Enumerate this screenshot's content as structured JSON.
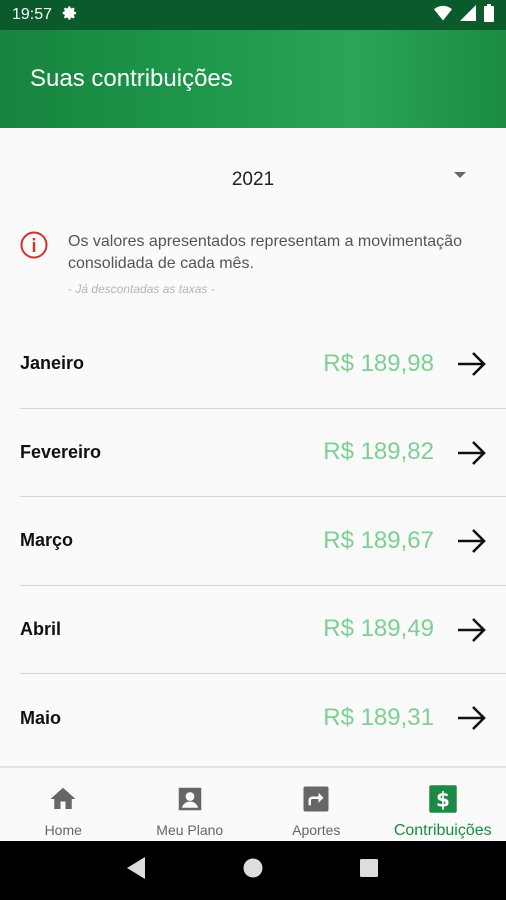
{
  "status_bar": {
    "time": "19:57"
  },
  "app_bar": {
    "title": "Suas contribuições"
  },
  "filter": {
    "year": "2021"
  },
  "notice": {
    "message": "Os valores apresentados representam a movimentação consolidada de cada mês.",
    "note": "- Já descontadas as taxas -"
  },
  "months": [
    {
      "name": "Janeiro",
      "amount": "R$ 189,98"
    },
    {
      "name": "Fevereiro",
      "amount": "R$ 189,82"
    },
    {
      "name": "Março",
      "amount": "R$ 189,67"
    },
    {
      "name": "Abril",
      "amount": "R$ 189,49"
    },
    {
      "name": "Maio",
      "amount": "R$ 189,31"
    }
  ],
  "bottom_nav": [
    {
      "label": "Home",
      "icon": "home-icon"
    },
    {
      "label": "Meu Plano",
      "icon": "person-icon"
    },
    {
      "label": "Aportes",
      "icon": "share-icon"
    },
    {
      "label": "Contribuições",
      "icon": "dollar-icon",
      "active": true
    }
  ],
  "colors": {
    "primary": "#1b8a45",
    "amount": "#7dcf92",
    "alert": "#d32f2f"
  }
}
